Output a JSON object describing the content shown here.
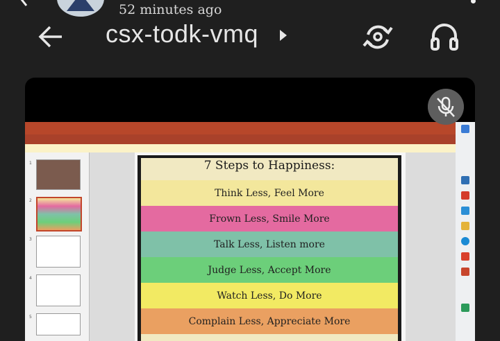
{
  "header": {
    "timestamp": "52 minutes ago",
    "meeting_title": "csx-todk-vmq",
    "icons": {
      "back_top": "chevron-left-icon",
      "avatar": "avatar",
      "menu": "more-vert-icon",
      "back": "arrow-back-icon",
      "rotate_camera": "rotate-camera-icon",
      "audio": "headphones-icon"
    }
  },
  "video": {
    "mic_icon": "mic-off-icon"
  },
  "slide": {
    "title": "7 Steps to Happiness:",
    "steps": [
      {
        "text": "Think Less, Feel More",
        "color": "#f3e79c"
      },
      {
        "text": "Frown Less, Smile More",
        "color": "#e46aa0"
      },
      {
        "text": "Talk Less, Listen more",
        "color": "#7fc1a8"
      },
      {
        "text": "Judge Less, Accept More",
        "color": "#6ccf7a"
      },
      {
        "text": "Watch Less, Do More",
        "color": "#f2ea63"
      },
      {
        "text": "Complain Less, Appreciate More",
        "color": "#eaa061"
      }
    ]
  },
  "thumbnails": [
    "1",
    "2",
    "3",
    "4",
    "5"
  ],
  "colors": {
    "background": "#1f1f1f",
    "ppt_accent": "#b7472a"
  }
}
